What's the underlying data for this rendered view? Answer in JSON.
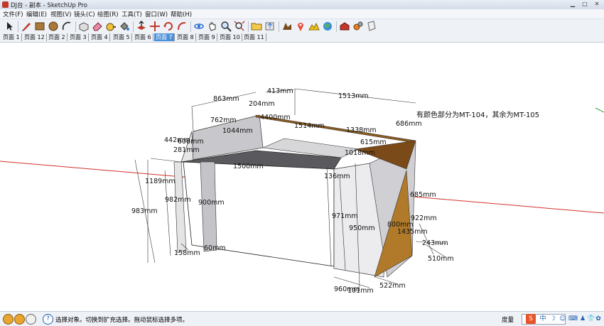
{
  "window": {
    "title": "DJ台 - 副本 - SketchUp Pro",
    "controls": {
      "minimize": "▁",
      "maximize": "□",
      "close": "✕"
    }
  },
  "menu": [
    "文件(F)",
    "编辑(E)",
    "视图(V)",
    "镜头(C)",
    "绘图(R)",
    "工具(T)",
    "窗口(W)",
    "帮助(H)"
  ],
  "toolbar": {
    "tools": [
      {
        "name": "select-tool",
        "icon": "cursor-arrow"
      },
      {
        "name": "pencil-tool",
        "icon": "pencil"
      },
      {
        "name": "rectangle-tool",
        "icon": "rectangle"
      },
      {
        "name": "circle-tool",
        "icon": "circle"
      },
      {
        "name": "arc-tool",
        "icon": "arc"
      },
      {
        "name": "make-component-tool",
        "icon": "component-box"
      },
      {
        "name": "eraser-tool",
        "icon": "eraser"
      },
      {
        "name": "tape-measure-tool",
        "icon": "tape-measure"
      },
      {
        "name": "paint-bucket-tool",
        "icon": "paint-bucket"
      },
      {
        "name": "push-pull-tool",
        "icon": "push-pull"
      },
      {
        "name": "move-tool",
        "icon": "move-cross"
      },
      {
        "name": "rotate-tool",
        "icon": "rotate"
      },
      {
        "name": "follow-me-tool",
        "icon": "follow-me"
      },
      {
        "name": "orbit-tool",
        "icon": "orbit"
      },
      {
        "name": "pan-tool",
        "icon": "hand"
      },
      {
        "name": "zoom-tool",
        "icon": "magnifier"
      },
      {
        "name": "zoom-extents-tool",
        "icon": "zoom-extents"
      },
      {
        "name": "get-models-tool",
        "icon": "folder"
      },
      {
        "name": "share-model-tool",
        "icon": "share"
      },
      {
        "name": "get-photo-texture-tool",
        "icon": "photo"
      },
      {
        "name": "add-location-tool",
        "icon": "pin"
      },
      {
        "name": "toggle-terrain-tool",
        "icon": "terrain"
      },
      {
        "name": "preview-earth-tool",
        "icon": "globe"
      },
      {
        "name": "extension-warehouse-tool",
        "icon": "warehouse"
      },
      {
        "name": "extension-manager-tool",
        "icon": "gears"
      },
      {
        "name": "layout-tool",
        "icon": "layout-doc"
      }
    ]
  },
  "tabs": [
    {
      "label": "页面 1",
      "active": false
    },
    {
      "label": "页面 12",
      "active": false
    },
    {
      "label": "页面 2",
      "active": false
    },
    {
      "label": "页面 3",
      "active": false
    },
    {
      "label": "页面 4",
      "active": false
    },
    {
      "label": "页面 5",
      "active": false
    },
    {
      "label": "页面 6",
      "active": false
    },
    {
      "label": "页面 7",
      "active": true
    },
    {
      "label": "页面 8",
      "active": false
    },
    {
      "label": "页面 9",
      "active": false
    },
    {
      "label": "页面 10",
      "active": false
    },
    {
      "label": "页面 11",
      "active": false
    }
  ],
  "canvas": {
    "note": "有颜色部分为MT-104，其余为MT-105",
    "dimensions": [
      "863mm",
      "413mm",
      "1513mm",
      "204mm",
      "762mm",
      "4400mm",
      "1044mm",
      "1514mm",
      "1338mm",
      "686mm",
      "442mm",
      "608mm",
      "281mm",
      "615mm",
      "1018mm",
      "1500mm",
      "136mm",
      "1189mm",
      "982mm",
      "900mm",
      "983mm",
      "685mm",
      "971mm",
      "950mm",
      "922mm",
      "1435mm",
      "800mm",
      "243mm",
      "158mm",
      "510mm",
      "60mm",
      "960mm",
      "101mm",
      "522mm",
      "1500mm"
    ]
  },
  "status": {
    "hint": "选择对象。切换到扩充选择。拖动鼠标选择多项。",
    "measurement_label": "度量",
    "tray": [
      "S",
      "中",
      "☽",
      "☺",
      "⌨",
      "♟",
      "👕",
      "✿"
    ]
  },
  "colors": {
    "accent": "#4a90d9",
    "wood": "#b07a2a",
    "red_axis": "#d0312d",
    "green_axis": "#2e9e3a"
  }
}
